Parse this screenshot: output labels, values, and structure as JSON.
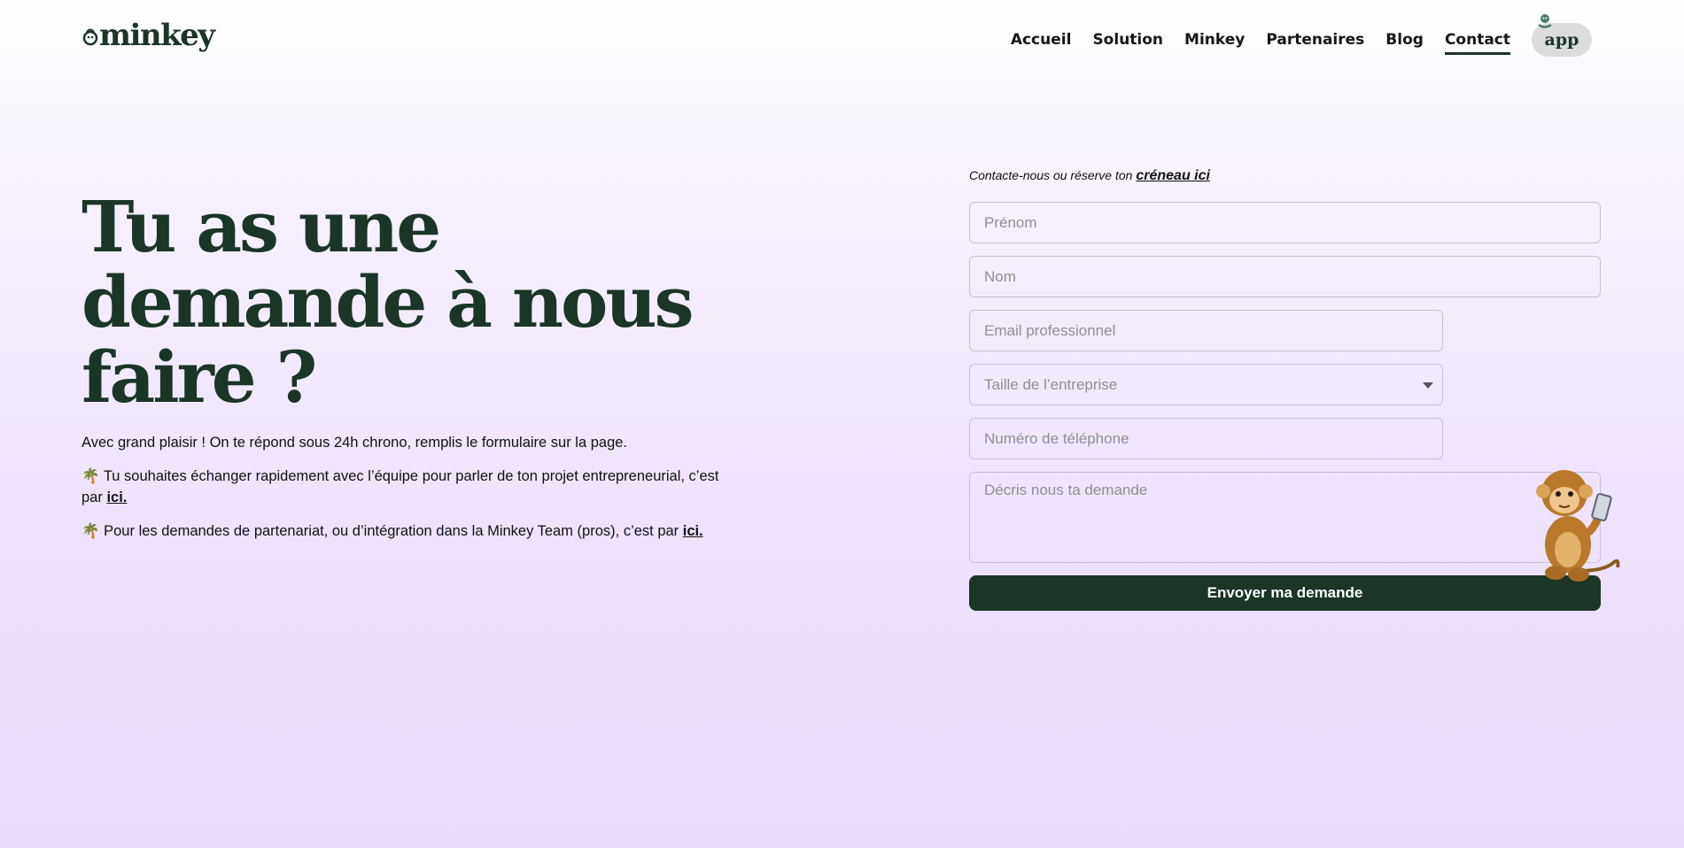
{
  "header": {
    "logo_text": "minkey",
    "nav": [
      {
        "label": "Accueil"
      },
      {
        "label": "Solution"
      },
      {
        "label": "Minkey"
      },
      {
        "label": "Partenaires"
      },
      {
        "label": "Blog"
      },
      {
        "label": "Contact",
        "active": true
      }
    ],
    "app_button": "app"
  },
  "hero": {
    "title": "Tu as une demande à nous faire ?",
    "intro": "Avec grand plaisir ! On te répond sous 24h chrono, remplis le formulaire sur la page.",
    "p2_text": "🌴 Tu souhaites échanger rapidement avec l’équipe pour parler de ton projet entrepreneurial, c’est par ",
    "p2_link": "ici.",
    "p3_text": "🌴 Pour les demandes de partenariat, ou d’intégration dans la Minkey Team (pros), c’est par ",
    "p3_link": "ici."
  },
  "form": {
    "intro_text": "Contacte-nous ou réserve ton ",
    "intro_link": "créneau ici",
    "prenom_placeholder": "Prénom",
    "nom_placeholder": "Nom",
    "email_placeholder": "Email professionnel",
    "taille_selected": "Taille de l’entreprise",
    "tel_placeholder": "Numéro de téléphone",
    "desc_placeholder": "Décris nous ta demande",
    "submit_label": "Envoyer ma demande"
  },
  "colors": {
    "brand_green": "#1b3526",
    "app_button_bg": "#dcdcdc",
    "background_bottom": "#e9d9fd"
  },
  "icons": [
    "monkey-logo-icon",
    "monkey-mascot-icon",
    "chevron-down-icon",
    "palm-tree-icon"
  ]
}
